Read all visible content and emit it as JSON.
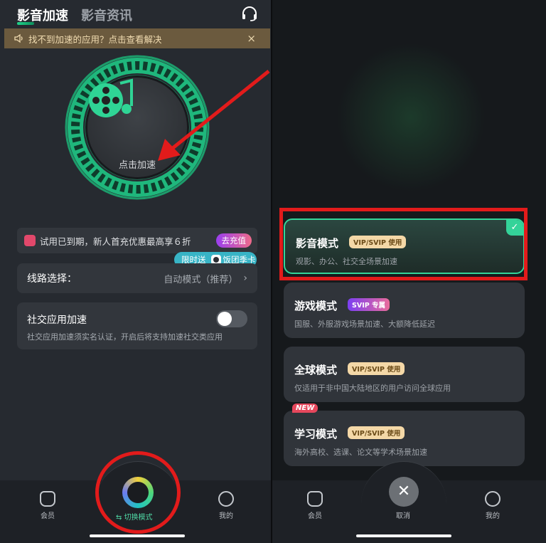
{
  "left": {
    "tabs": [
      {
        "label": "影音加速",
        "active": true
      },
      {
        "label": "影音资讯",
        "active": false
      }
    ],
    "notice": {
      "text": "找不到加速的应用？点击查看解决",
      "close": "×"
    },
    "accelerate_label": "点击加速",
    "trial": {
      "text": "试用已到期，新人首充优惠最高享６折",
      "button": "去充值"
    },
    "limited": {
      "prefix": "限时送",
      "item": "饭团季卡"
    },
    "route": {
      "label": "线路选择：",
      "value": "自动模式（推荐）",
      "chevron": "›"
    },
    "social": {
      "title": "社交应用加速",
      "desc": "社交应用加速须实名认证，开启后将支持加速社交类应用",
      "enabled": false
    },
    "bottom_nav": [
      {
        "label": "会员",
        "icon": "crown-icon"
      },
      {
        "label": "⇆ 切换模式",
        "icon": "film-reel-icon"
      },
      {
        "label": "我的",
        "icon": "smile-icon"
      }
    ]
  },
  "right": {
    "modes": [
      {
        "name": "影音模式",
        "tag": "VIP/SVIP 使用",
        "desc": "观影、办公、社交全场景加速",
        "selected": true
      },
      {
        "name": "游戏模式",
        "tag": "SVIP 专属",
        "desc": "国服、外服游戏场景加速、大额降低延迟",
        "selected": false
      },
      {
        "name": "全球模式",
        "tag": "VIP/SVIP 使用",
        "desc": "仅适用于非中国大陆地区的用户访问全球应用",
        "selected": false
      },
      {
        "name": "学习模式",
        "tag": "VIP/SVIP 使用",
        "desc": "海外高校、选课、论文等学术场景加速",
        "selected": false
      }
    ],
    "new_badge": "NEW",
    "bottom_nav": [
      {
        "label": "会员",
        "icon": "crown-icon"
      },
      {
        "label": "取消",
        "icon": "close-icon"
      },
      {
        "label": "我的",
        "icon": "smile-icon"
      }
    ]
  },
  "colors": {
    "accent": "#34d399",
    "annotation": "#e21b1b",
    "svip": "#9a3ff0"
  }
}
